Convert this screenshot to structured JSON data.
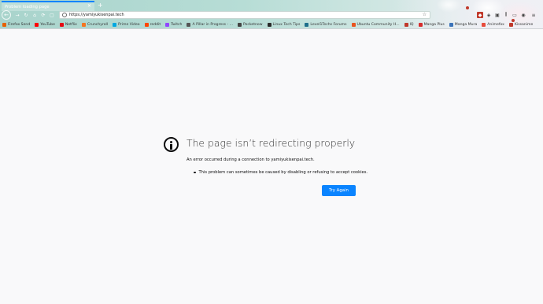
{
  "browser": {
    "tab_title": "Problem loading page",
    "url": "https://yamiyukisenpai.tech"
  },
  "bookmarks": [
    {
      "label": "Firefox Send",
      "color": "#e66000"
    },
    {
      "label": "YouTube",
      "color": "#ff0000"
    },
    {
      "label": "Netflix",
      "color": "#e50914"
    },
    {
      "label": "Crunchyroll",
      "color": "#f47521"
    },
    {
      "label": "Prime Video",
      "color": "#00a8e1"
    },
    {
      "label": "reddit",
      "color": "#ff4500"
    },
    {
      "label": "Twitch",
      "color": "#9146ff"
    },
    {
      "label": "A Pillar in Progress - ...",
      "color": "#555555"
    },
    {
      "label": "Pocketnow",
      "color": "#444444"
    },
    {
      "label": "Linux Tech Tips",
      "color": "#2b2b2b"
    },
    {
      "label": "Level1Techs Forums",
      "color": "#1f6f8b"
    },
    {
      "label": "Ubuntu Community H...",
      "color": "#e95420"
    },
    {
      "label": "IQ",
      "color": "#c0392b"
    },
    {
      "label": "Manga Plus",
      "color": "#d62d2d"
    },
    {
      "label": "Manga Mura",
      "color": "#3b73b9"
    },
    {
      "label": "Animefox",
      "color": "#e74c3c"
    },
    {
      "label": "Kissanime",
      "color": "#c0392b"
    }
  ],
  "error": {
    "title": "The page isn’t redirecting properly",
    "description": "An error occurred during a connection to yamiyukisenpai.tech.",
    "bullets": [
      "This problem can sometimes be caused by disabling or refusing to accept cookies."
    ],
    "button_label": "Try Again"
  },
  "colors": {
    "accent": "#0a84ff",
    "page_background": "#f9f9fa",
    "toolbar": "#b7ddd6"
  }
}
